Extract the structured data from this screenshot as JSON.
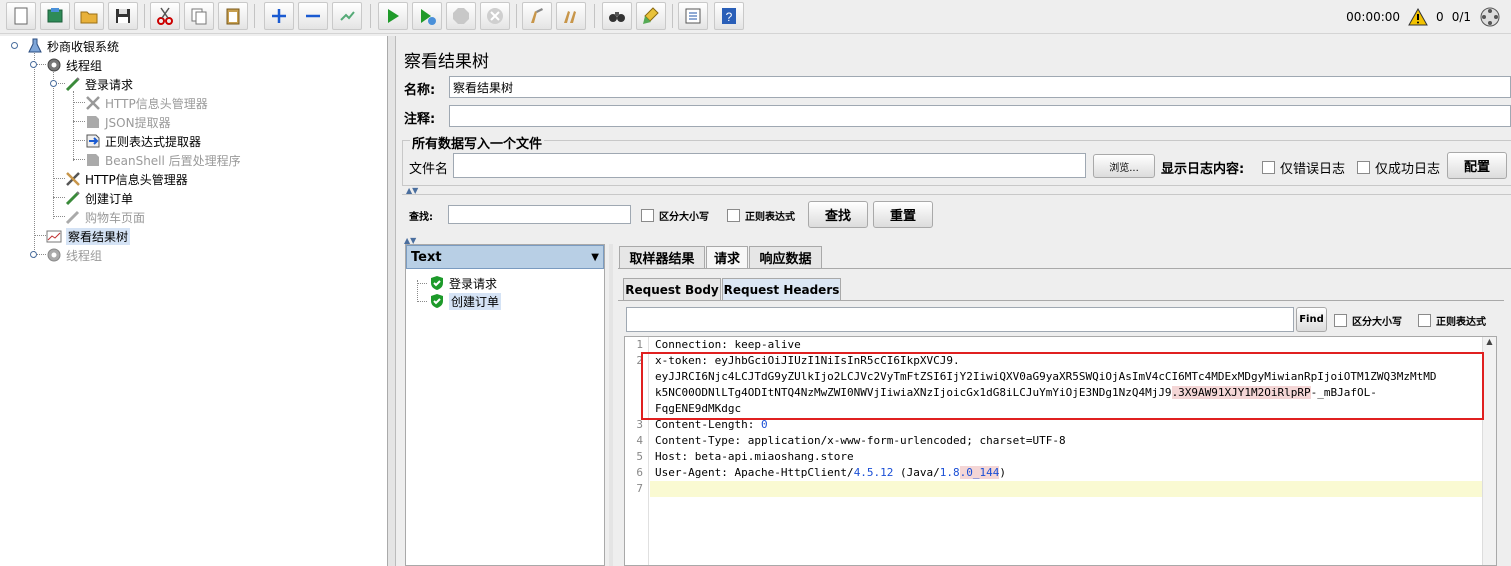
{
  "toolbar": {
    "buttons": [
      {
        "name": "new-icon"
      },
      {
        "name": "templates-icon"
      },
      {
        "name": "open-icon"
      },
      {
        "name": "save-icon"
      },
      {
        "name": "cut-icon"
      },
      {
        "name": "copy-icon"
      },
      {
        "name": "paste-icon"
      },
      {
        "name": "expand-icon"
      },
      {
        "name": "collapse-icon"
      },
      {
        "name": "toggle-icon"
      },
      {
        "name": "start-icon"
      },
      {
        "name": "start-no-timers-icon"
      },
      {
        "name": "stop-icon"
      },
      {
        "name": "shutdown-icon"
      },
      {
        "name": "clear-icon"
      },
      {
        "name": "clear-all-icon"
      },
      {
        "name": "search-icon"
      },
      {
        "name": "reset-search-icon"
      },
      {
        "name": "function-helper-icon"
      },
      {
        "name": "help-icon"
      }
    ],
    "timer": "00:00:00",
    "warn_count": "0",
    "threads": "0/1"
  },
  "tree": {
    "items": [
      {
        "label": "秒商收银系统",
        "icon": "testplan-icon"
      },
      {
        "label": "线程组",
        "icon": "gear-icon"
      },
      {
        "label": "登录请求",
        "icon": "sampler-icon"
      },
      {
        "label": "HTTP信息头管理器",
        "icon": "wrench-icon"
      },
      {
        "label": "JSON提取器",
        "icon": "extractor-icon"
      },
      {
        "label": "正则表达式提取器",
        "icon": "extractor-icon"
      },
      {
        "label": "BeanShell 后置处理程序",
        "icon": "extractor-icon"
      },
      {
        "label": "HTTP信息头管理器",
        "icon": "wrench-icon"
      },
      {
        "label": "创建订单",
        "icon": "sampler-icon"
      },
      {
        "label": "购物车页面",
        "icon": "sampler-icon"
      },
      {
        "label": "察看结果树",
        "icon": "listener-icon"
      },
      {
        "label": "线程组",
        "icon": "gear-icon"
      }
    ]
  },
  "panel": {
    "title": "察看结果树",
    "name_label": "名称:",
    "name_value": "察看结果树",
    "comment_label": "注释:",
    "comment_value": "",
    "file_section": "所有数据写入一个文件",
    "filename_label": "文件名",
    "filename_value": "",
    "browse_label": "浏览...",
    "log_label": "显示日志内容:",
    "errors_only": "仅错误日志",
    "success_only": "仅成功日志",
    "configure_label": "配置",
    "search_label": "查找:",
    "search_value": "",
    "case_label": "区分大小写",
    "regex_label": "正则表达式",
    "search_btn": "查找",
    "reset_btn": "重置",
    "renderer": "Text",
    "results": [
      "登录请求",
      "创建订单"
    ],
    "tabs": [
      "取样器结果",
      "请求",
      "响应数据"
    ],
    "subtabs": [
      "Request Body",
      "Request Headers"
    ],
    "find_value": "",
    "find_btn": "Find",
    "find_case": "区分大小写",
    "find_regex": "正则表达式"
  },
  "code": {
    "lines": [
      {
        "n": "1",
        "text": "Connection: keep-alive"
      },
      {
        "n": "2",
        "text": "x-token: eyJhbGciOiJIUzI1NiIsInR5cCI6IkpXVCJ9."
      },
      {
        "n": "",
        "text": "eyJJRCI6Njc4LCJTdG9yZUlkIjo2LCJVc2VyTmFtZSI6IjY2IiwiQXV0aG9yaXR5SWQiOjAsImV4cCI6MTc4MDExMDgyMiwianRpIjoiOTM1ZWQ3MzMtMD"
      },
      {
        "n": "",
        "text_a": "k5NC00ODNlLTg4ODItNTQ4NzMwZWI0NWVjIiwiaXNzIjoicGx1dG8iLCJuYmYiOjE3NDg1NzQ4MjJ9",
        "text_b": ".3X9AW91XJY1M2OiRlpRP",
        "text_c": "-_mBJafOL-"
      },
      {
        "n": "",
        "text": "FqgENE9dMKdgc"
      },
      {
        "n": "3",
        "text_a": "Content-Length: ",
        "text_b": "0"
      },
      {
        "n": "4",
        "text": "Content-Type: application/x-www-form-urlencoded; charset=UTF-8"
      },
      {
        "n": "5",
        "text": "Host: beta-api.miaoshang.store"
      },
      {
        "n": "6",
        "text_a": "User-Agent: Apache-HttpClient/",
        "text_b": "4.5.12",
        "text_c": " (Java/",
        "text_d": "1.8",
        "text_e": ".0_144",
        ")": ")",
        "text_f": ")"
      },
      {
        "n": "7",
        "text": ""
      }
    ]
  },
  "colors": {
    "highlight_box": "#e02020",
    "current_line": "#fafad2"
  }
}
